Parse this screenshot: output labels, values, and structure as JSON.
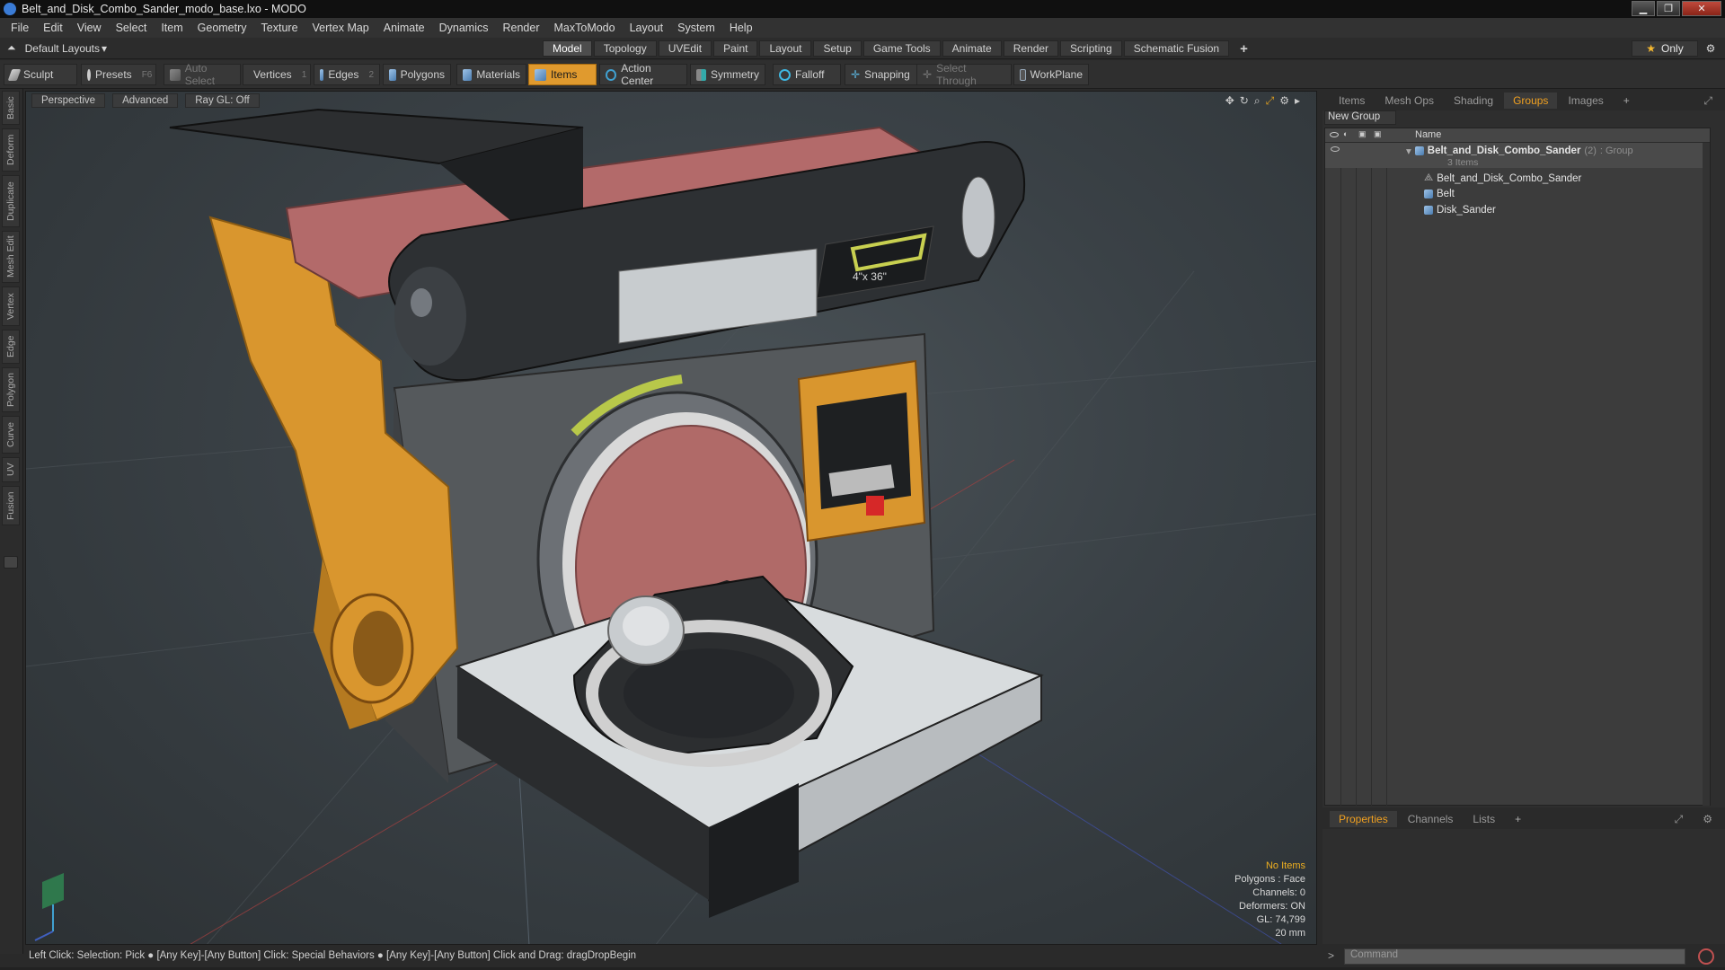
{
  "window": {
    "title": "Belt_and_Disk_Combo_Sander_modo_base.lxo - MODO"
  },
  "menu": [
    "File",
    "Edit",
    "View",
    "Select",
    "Item",
    "Geometry",
    "Texture",
    "Vertex Map",
    "Animate",
    "Dynamics",
    "Render",
    "MaxToModo",
    "Layout",
    "System",
    "Help"
  ],
  "layout_selector": "Default Layouts",
  "mode_tabs": [
    "Model",
    "Topology",
    "UVEdit",
    "Paint",
    "Layout",
    "Setup",
    "Game Tools",
    "Animate",
    "Render",
    "Scripting",
    "Schematic Fusion"
  ],
  "mode_tabs_active": "Model",
  "only_label": "Only",
  "toolbar": {
    "sculpt": "Sculpt",
    "presets": "Presets",
    "presets_key": "F6",
    "auto_select": "Auto Select",
    "vertices": "Vertices",
    "vertices_key": "1",
    "edges": "Edges",
    "edges_key": "2",
    "polygons": "Polygons",
    "materials": "Materials",
    "items": "Items",
    "action_center": "Action Center",
    "symmetry": "Symmetry",
    "falloff": "Falloff",
    "snapping": "Snapping",
    "select_through": "Select Through",
    "workplane": "WorkPlane"
  },
  "left_tabs": [
    "Basic",
    "Deform",
    "Duplicate",
    "Mesh Edit",
    "Vertex",
    "Edge",
    "Polygon",
    "Curve",
    "UV",
    "Fusion"
  ],
  "viewport": {
    "view_mode": "Perspective",
    "shading": "Advanced",
    "raygl": "Ray GL: Off",
    "info": {
      "no_items": "No Items",
      "polygons": "Polygons : Face",
      "channels": "Channels: 0",
      "deformers": "Deformers: ON",
      "gl": "GL: 74,799",
      "scale": "20 mm"
    },
    "decal_label": "4\"x 36\""
  },
  "status_bar": "Left Click: Selection: Pick ● [Any Key]-[Any Button] Click: Special Behaviors ● [Any Key]-[Any Button] Click and Drag: dragDropBegin",
  "right_panel": {
    "tabs": [
      "Items",
      "Mesh Ops",
      "Shading",
      "Groups",
      "Images"
    ],
    "active_tab": "Groups",
    "new_group": "New Group",
    "column_name": "Name",
    "group": {
      "name": "Belt_and_Disk_Combo_Sander",
      "count": "(2)",
      "type": ": Group",
      "subtitle": "3 Items"
    },
    "children": [
      "Belt_and_Disk_Combo_Sander",
      "Belt",
      "Disk_Sander"
    ]
  },
  "properties_panel": {
    "tabs": [
      "Properties",
      "Channels",
      "Lists"
    ],
    "active_tab": "Properties"
  },
  "command": {
    "placeholder": "Command"
  },
  "colors": {
    "accent": "#e09a2e",
    "active_tab_text": "#f0a020",
    "viewport_bg": "#3a4146",
    "warning_text": "#f0b020"
  }
}
